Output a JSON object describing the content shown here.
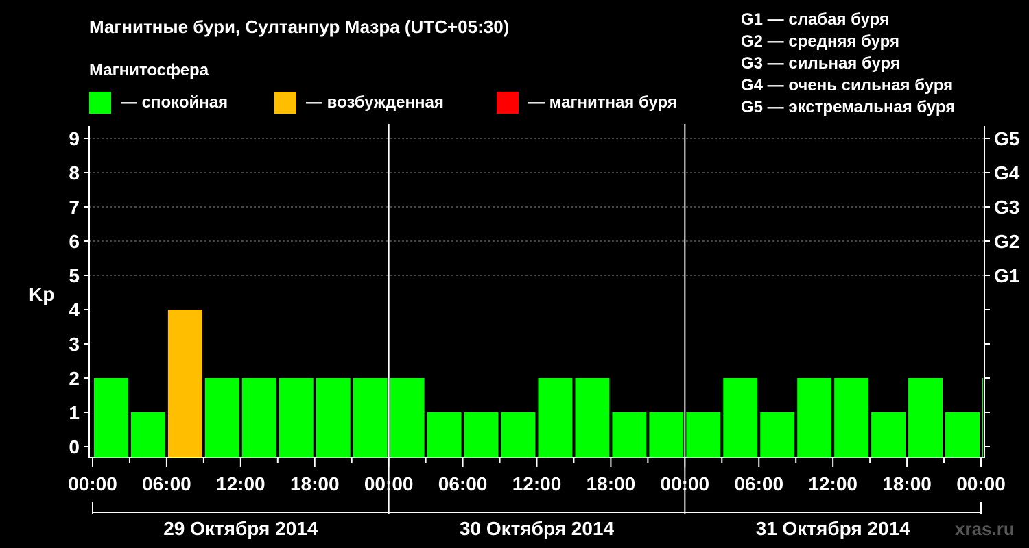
{
  "chart_data": {
    "type": "bar",
    "title": "Магнитные бури, Султанпур Мазра (UTC+05:30)",
    "ylabel": "Kp",
    "ylim": [
      0,
      9
    ],
    "yticks": [
      "0",
      "1",
      "2",
      "3",
      "4",
      "5",
      "6",
      "7",
      "8",
      "9"
    ],
    "g_scale_labels": [
      {
        "kp": 5,
        "label": "G1"
      },
      {
        "kp": 6,
        "label": "G2"
      },
      {
        "kp": 7,
        "label": "G3"
      },
      {
        "kp": 8,
        "label": "G4"
      },
      {
        "kp": 9,
        "label": "G5"
      }
    ],
    "x_tick_labels": [
      "00:00",
      "06:00",
      "12:00",
      "18:00",
      "00:00",
      "06:00",
      "12:00",
      "18:00",
      "00:00",
      "06:00",
      "12:00",
      "18:00",
      "00:00"
    ],
    "days": [
      "29 Октября 2014",
      "30 Октября 2014",
      "31 Октября 2014"
    ],
    "legend_title": "Магнитосфера",
    "legend": [
      {
        "label": "— спокойная",
        "color": "#00ff00"
      },
      {
        "label": "— возбужденная",
        "color": "#ffbf00"
      },
      {
        "label": "— магнитная буря",
        "color": "#ff0000"
      }
    ],
    "g_legend": [
      "G1 — слабая буря",
      "G2 — средняя буря",
      "G3 — сильная буря",
      "G4 — очень сильная буря",
      "G5 — экстремальная буря"
    ],
    "values": [
      2,
      1,
      4,
      2,
      2,
      2,
      2,
      2,
      2,
      1,
      1,
      1,
      2,
      2,
      1,
      1,
      1,
      2,
      1,
      2,
      2,
      1,
      2,
      1,
      2
    ],
    "colors": {
      "quiet": "#00ff00",
      "active": "#ffbf00",
      "storm": "#ff0000"
    },
    "grid": "dashed horizontal at Kp 5-9",
    "watermark": "xras.ru"
  }
}
